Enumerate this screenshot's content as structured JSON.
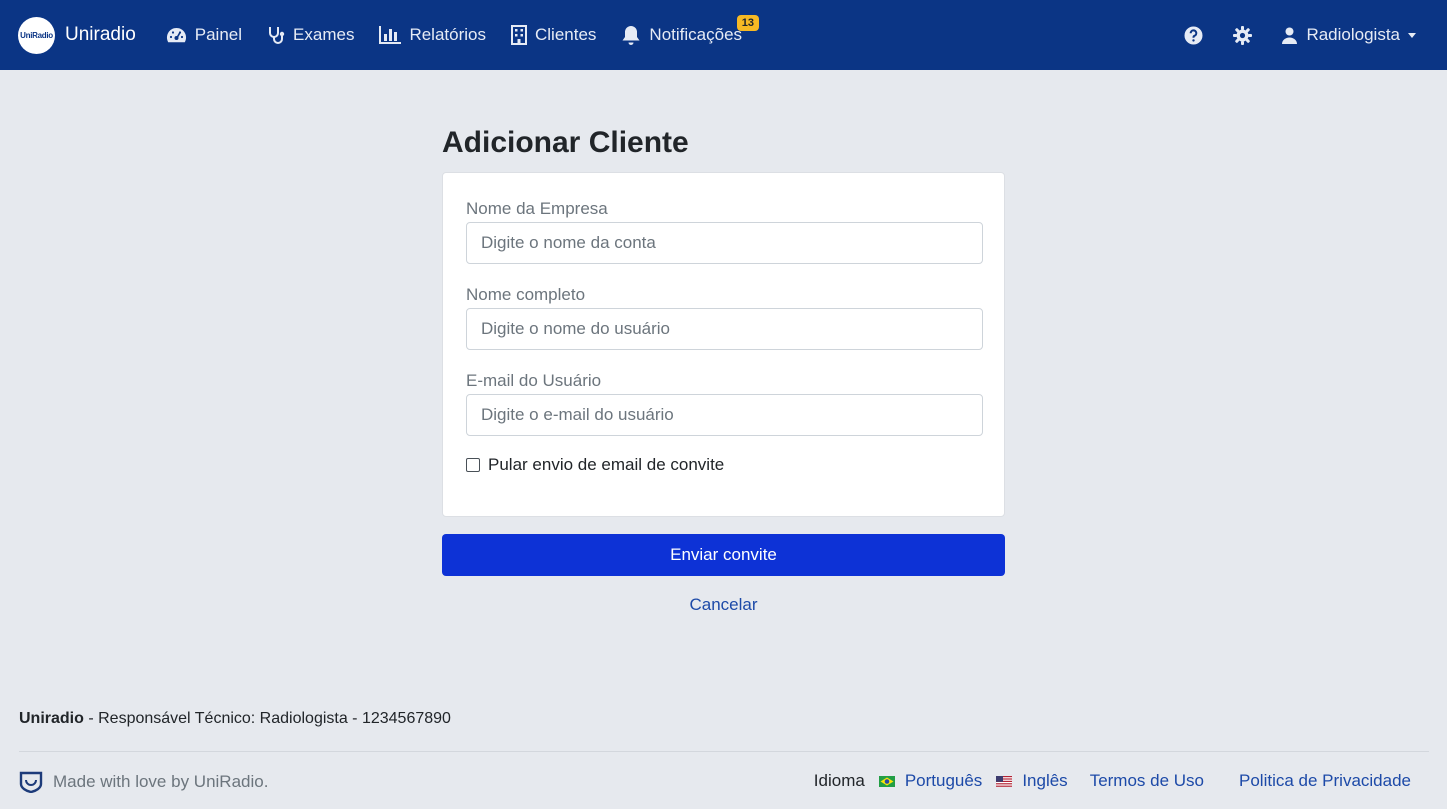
{
  "navbar": {
    "brand": "Uniradio",
    "logo_text": "UniRadio",
    "items": [
      {
        "label": "Painel",
        "icon": "dashboard-icon"
      },
      {
        "label": "Exames",
        "icon": "stethoscope-icon"
      },
      {
        "label": "Relatórios",
        "icon": "bar-chart-icon"
      },
      {
        "label": "Clientes",
        "icon": "building-icon"
      },
      {
        "label": "Notificações",
        "icon": "bell-icon",
        "badge": "13"
      }
    ],
    "user": "Radiologista"
  },
  "form": {
    "title": "Adicionar Cliente",
    "company_label": "Nome da Empresa",
    "company_placeholder": "Digite o nome da conta",
    "fullname_label": "Nome completo",
    "fullname_placeholder": "Digite o nome do usuário",
    "email_label": "E-mail do Usuário",
    "email_placeholder": "Digite o e-mail do usuário",
    "skip_invite_label": "Pular envio de email de convite",
    "skip_invite_checked": false,
    "submit_label": "Enviar convite",
    "cancel_label": "Cancelar"
  },
  "footer": {
    "brand": "Uniradio",
    "responsible": " - Responsável Técnico: Radiologista - 1234567890",
    "made_with": "Made with love by UniRadio.",
    "language_label": "Idioma",
    "languages": [
      "Português",
      "Inglês"
    ],
    "terms": "Termos de Uso",
    "privacy": "Politica de Privacidade"
  },
  "colors": {
    "navbar": "#0b3585",
    "primary_button": "#0d32d6",
    "badge": "#f7b924",
    "background": "#e6e9ee",
    "link": "#1d4aa8"
  }
}
